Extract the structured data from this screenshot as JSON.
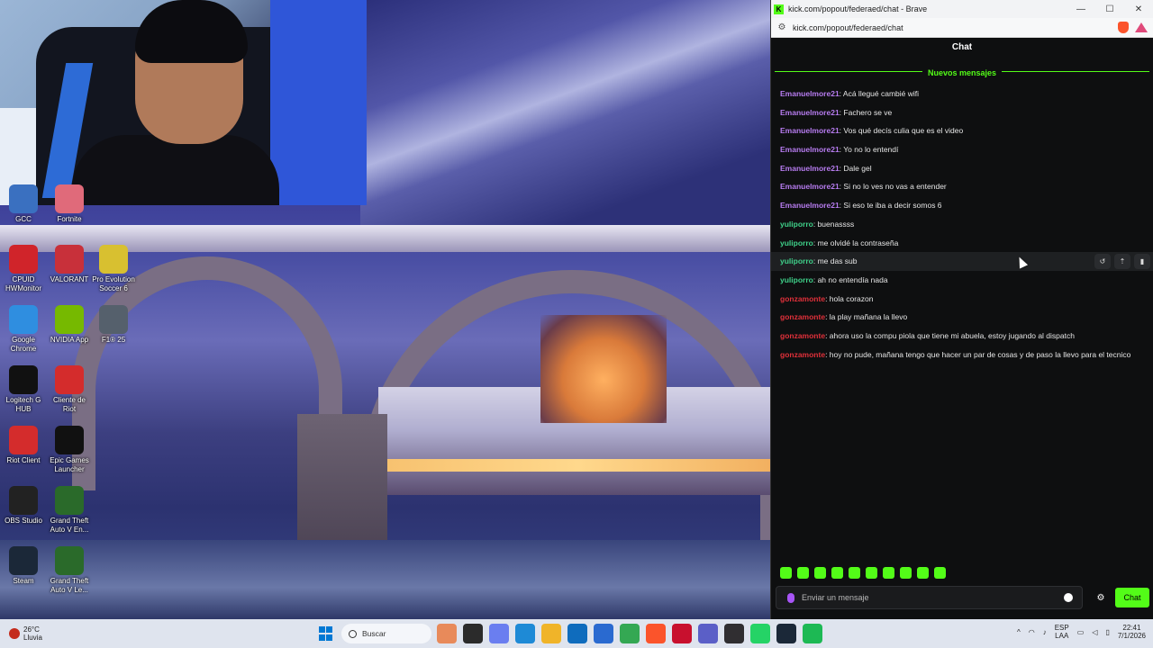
{
  "desktop": {
    "icons": [
      {
        "label": "GCC",
        "icon": "gcc-icon",
        "color": "#3a70c0"
      },
      {
        "label": "Fortnite",
        "icon": "fortnite-icon",
        "color": "#e06a7a"
      },
      {
        "label": "CPUID HWMonitor",
        "icon": "hwmonitor-icon",
        "color": "#d0242a"
      },
      {
        "label": "VALORANT",
        "icon": "valorant-icon",
        "color": "#c8303a"
      },
      {
        "label": "Pro Evolution Soccer 6",
        "icon": "pes-icon",
        "color": "#d8c030"
      },
      {
        "label": "Google Chrome",
        "icon": "chrome-icon",
        "color": "#2f8ee0"
      },
      {
        "label": "NVIDIA App",
        "icon": "nvidia-icon",
        "color": "#76b900"
      },
      {
        "label": "F1® 25",
        "icon": "f1-icon",
        "color": "#55606c"
      },
      {
        "label": "Logitech G HUB",
        "icon": "ghub-icon",
        "color": "#111111"
      },
      {
        "label": "Cliente de Riot",
        "icon": "riot-icon",
        "color": "#d42c2c"
      },
      {
        "label": "Riot Client",
        "icon": "riot-client-icon",
        "color": "#d42c2c"
      },
      {
        "label": "Epic Games Launcher",
        "icon": "epic-icon",
        "color": "#111111"
      },
      {
        "label": "OBS Studio",
        "icon": "obs-icon",
        "color": "#222222"
      },
      {
        "label": "Grand Theft Auto V En...",
        "icon": "gta-icon",
        "color": "#2a6a2a"
      },
      {
        "label": "Steam",
        "icon": "steam-icon",
        "color": "#1b2838"
      },
      {
        "label": "Grand Theft Auto V Le...",
        "icon": "gta-legacy-icon",
        "color": "#2a6a2a"
      }
    ]
  },
  "browser": {
    "title": "kick.com/popout/federaed/chat - Brave",
    "url": "kick.com/popout/federaed/chat",
    "minimize": "—",
    "maximize": "☐",
    "close": "✕"
  },
  "chat": {
    "header": "Chat",
    "new_messages_label": "Nuevos mensajes",
    "messages": [
      {
        "user": "Emanuelmore21",
        "text": ": Acá llegué cambié wifi",
        "color": "#b77cf0"
      },
      {
        "user": "Emanuelmore21",
        "text": ": Fachero se ve",
        "color": "#b77cf0"
      },
      {
        "user": "Emanuelmore21",
        "text": ": Vos qué decís culia que es el video",
        "color": "#b77cf0"
      },
      {
        "user": "Emanuelmore21",
        "text": ": Yo no lo entendí",
        "color": "#b77cf0"
      },
      {
        "user": "Emanuelmore21",
        "text": ": Dale gel",
        "color": "#b77cf0"
      },
      {
        "user": "Emanuelmore21",
        "text": ": Si no lo ves no vas a entender",
        "color": "#b77cf0"
      },
      {
        "user": "Emanuelmore21",
        "text": ": Si eso te iba a decir somos 6",
        "color": "#b77cf0"
      },
      {
        "user": "yuliporro",
        "text": ": buenassss",
        "color": "#3fd18a"
      },
      {
        "user": "yuliporro",
        "text": ": me olvidé la contraseña",
        "color": "#3fd18a"
      },
      {
        "user": "yuliporro",
        "text": ": me das sub",
        "color": "#3fd18a"
      },
      {
        "user": "yuliporro",
        "text": ": ah no entendía nada",
        "color": "#3fd18a"
      },
      {
        "user": "gonzamonte",
        "text": ": hola corazon",
        "color": "#e0303a"
      },
      {
        "user": "gonzamonte",
        "text": ": la play mañana la llevo",
        "color": "#e0303a"
      },
      {
        "user": "gonzamonte",
        "text": ": ahora uso la compu piola que tiene mi abuela, estoy jugando al dispatch",
        "color": "#e0303a"
      },
      {
        "user": "gonzamonte",
        "text": ": hoy no pude, mañana tengo que hacer un par de cosas y de paso la llevo para el tecnico",
        "color": "#e0303a"
      }
    ],
    "hovered_index": 9,
    "input_placeholder": "Enviar un mensaje",
    "send_label": "Chat",
    "accent": "#53fc18"
  },
  "taskbar": {
    "weather_temp": "26°C",
    "weather_desc": "Lluvia",
    "weather_badge": "4",
    "search_placeholder": "Buscar",
    "lang_top": "ESP",
    "lang_bottom": "LAA",
    "time": "22:41",
    "date": "7/1/2026",
    "pinned": [
      {
        "name": "app-icon-1",
        "color": "#e88a5a"
      },
      {
        "name": "file-explorer-icon",
        "color": "#2b2b2b"
      },
      {
        "name": "copilot-icon",
        "color": "#6a7ef0"
      },
      {
        "name": "edge-icon",
        "color": "#1e8ad6"
      },
      {
        "name": "folder-icon",
        "color": "#f0b429"
      },
      {
        "name": "outlook-icon",
        "color": "#0f6cbd"
      },
      {
        "name": "calendar-icon",
        "color": "#2a6ad0"
      },
      {
        "name": "chrome-icon",
        "color": "#34a853"
      },
      {
        "name": "brave-icon",
        "color": "#fb542b"
      },
      {
        "name": "flash-icon",
        "color": "#c8102e"
      },
      {
        "name": "teams-icon",
        "color": "#5b5fc7"
      },
      {
        "name": "obs-icon",
        "color": "#302e31"
      },
      {
        "name": "whatsapp-icon",
        "color": "#25d366"
      },
      {
        "name": "steam-icon",
        "color": "#1b2838"
      },
      {
        "name": "spotify-icon",
        "color": "#1db954"
      }
    ]
  }
}
